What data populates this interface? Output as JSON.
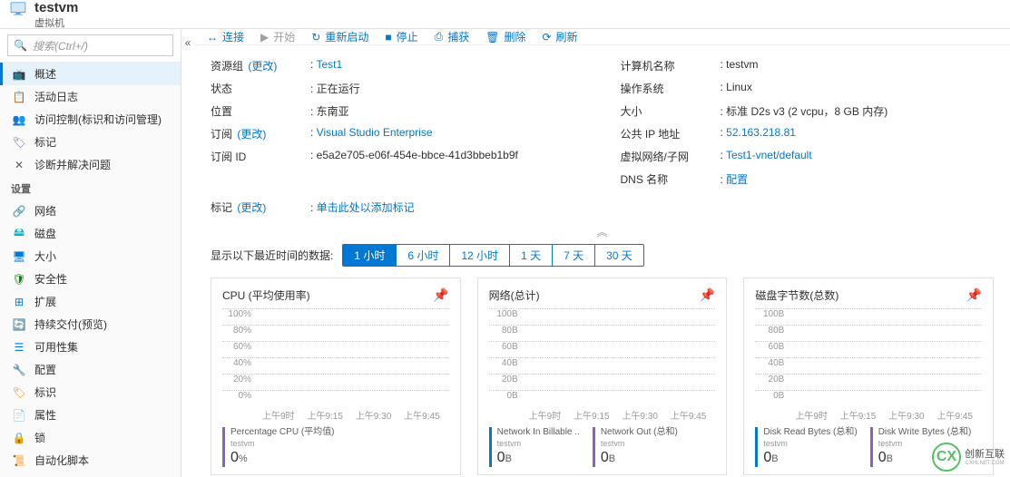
{
  "header": {
    "title": "testvm",
    "subtitle": "虚拟机"
  },
  "search": {
    "placeholder": "搜索(Ctrl+/)"
  },
  "nav": {
    "top": [
      {
        "icon": "📺",
        "label": "概述",
        "color": "c-blue"
      },
      {
        "icon": "📋",
        "label": "活动日志",
        "color": "c-blue"
      },
      {
        "icon": "👥",
        "label": "访问控制(标识和访问管理)",
        "color": "c-blue"
      },
      {
        "icon": "🏷",
        "label": "标记",
        "color": "c-purple"
      },
      {
        "icon": "✕",
        "label": "诊断并解决问题",
        "color": "c-gray"
      }
    ],
    "section": "设置",
    "settings": [
      {
        "icon": "🔗",
        "label": "网络",
        "color": "c-orange"
      },
      {
        "icon": "🖴",
        "label": "磁盘",
        "color": "c-teal"
      },
      {
        "icon": "🖥",
        "label": "大小",
        "color": "c-blue"
      },
      {
        "icon": "🛡",
        "label": "安全性",
        "color": "c-green"
      },
      {
        "icon": "⊞",
        "label": "扩展",
        "color": "c-blue"
      },
      {
        "icon": "🔄",
        "label": "持续交付(预览)",
        "color": "c-blue"
      },
      {
        "icon": "☰",
        "label": "可用性集",
        "color": "c-blue"
      },
      {
        "icon": "🔧",
        "label": "配置",
        "color": "c-red"
      },
      {
        "icon": "🏷",
        "label": "标识",
        "color": "c-orange"
      },
      {
        "icon": "📄",
        "label": "属性",
        "color": "c-blue"
      },
      {
        "icon": "🔒",
        "label": "锁",
        "color": "c-gray"
      },
      {
        "icon": "📜",
        "label": "自动化脚本",
        "color": "c-blue"
      }
    ]
  },
  "toolbar": {
    "connect": "连接",
    "start": "开始",
    "restart": "重新启动",
    "stop": "停止",
    "capture": "捕获",
    "delete": "删除",
    "refresh": "刷新"
  },
  "props_left": {
    "rg_k": "资源组",
    "change": "(更改)",
    "rg_v": "Test1",
    "state_k": "状态",
    "state_v": "正在运行",
    "loc_k": "位置",
    "loc_v": "东南亚",
    "sub_k": "订阅",
    "sub_v": "Visual Studio Enterprise",
    "subid_k": "订阅 ID",
    "subid_v": "e5a2e705-e06f-454e-bbce-41d3bbeb1b9f"
  },
  "props_right": {
    "name_k": "计算机名称",
    "name_v": "testvm",
    "os_k": "操作系统",
    "os_v": "Linux",
    "size_k": "大小",
    "size_v": "标准 D2s v3 (2 vcpu，8 GB 内存)",
    "ip_k": "公共 IP 地址",
    "ip_v": "52.163.218.81",
    "vnet_k": "虚拟网络/子网",
    "vnet_v": "Test1-vnet/default",
    "dns_k": "DNS 名称",
    "dns_v": "配置"
  },
  "tags": {
    "k": "标记",
    "change": "(更改)",
    "v": "单击此处以添加标记"
  },
  "time": {
    "label": "显示以下最近时间的数据:",
    "opts": [
      "1 小时",
      "6 小时",
      "12 小时",
      "1 天",
      "7 天",
      "30 天"
    ]
  },
  "chart_data": [
    {
      "type": "line",
      "title": "CPU (平均使用率)",
      "yticks": [
        "100%",
        "80%",
        "60%",
        "40%",
        "20%",
        "0%"
      ],
      "xticks": [
        "上午9时",
        "上午9:15",
        "上午9:30",
        "上午9:45"
      ],
      "series": [
        {
          "name": "Percentage CPU (平均值)",
          "host": "testvm",
          "value": "0",
          "unit": "%",
          "color": "#8764b8"
        }
      ],
      "ylim": [
        0,
        100
      ]
    },
    {
      "type": "line",
      "title": "网络(总计)",
      "yticks": [
        "100B",
        "80B",
        "60B",
        "40B",
        "20B",
        "0B"
      ],
      "xticks": [
        "上午9时",
        "上午9:15",
        "上午9:30",
        "上午9:45"
      ],
      "series": [
        {
          "name": "Network In Billable ..",
          "host": "testvm",
          "value": "0",
          "unit": "B",
          "color": "#0078d4"
        },
        {
          "name": "Network Out (总和)",
          "host": "testvm",
          "value": "0",
          "unit": "B",
          "color": "#8764b8"
        }
      ],
      "ylim": [
        0,
        100
      ]
    },
    {
      "type": "line",
      "title": "磁盘字节数(总数)",
      "yticks": [
        "100B",
        "80B",
        "60B",
        "40B",
        "20B",
        "0B"
      ],
      "xticks": [
        "上午9时",
        "上午9:15",
        "上午9:30",
        "上午9:45"
      ],
      "series": [
        {
          "name": "Disk Read Bytes (总和)",
          "host": "testvm",
          "value": "0",
          "unit": "B",
          "color": "#0078d4"
        },
        {
          "name": "Disk Write Bytes (总和)",
          "host": "testvm",
          "value": "0",
          "unit": "B",
          "color": "#8764b8"
        }
      ],
      "ylim": [
        0,
        100
      ]
    }
  ],
  "brand": {
    "logo": "CX",
    "name": "创新互联",
    "sub": "CXHLNET.COM"
  }
}
